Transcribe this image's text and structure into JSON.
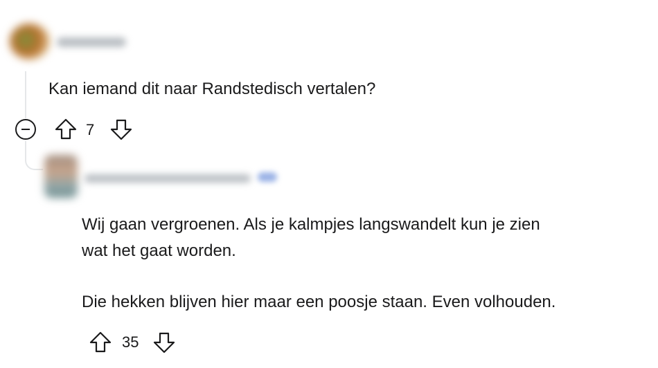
{
  "top_comment": {
    "body": "Kan iemand dit naar Randstedisch vertalen?",
    "score": "7",
    "collapse_icon": "minus-circle-icon",
    "upvote_icon": "arrow-up-icon",
    "downvote_icon": "arrow-down-icon"
  },
  "reply": {
    "lines": [
      "Wij gaan vergroenen. Als je kalmpjes langswandelt kun je zien",
      "wat het gaat worden.",
      "Die hekken blijven hier maar een poosje staan. Even volhouden."
    ],
    "score": "35",
    "upvote_icon": "arrow-up-icon",
    "downvote_icon": "arrow-down-icon"
  },
  "colors": {
    "text": "#1a1a1b",
    "thread_line": "#e5e7e9",
    "background": "#ffffff"
  }
}
